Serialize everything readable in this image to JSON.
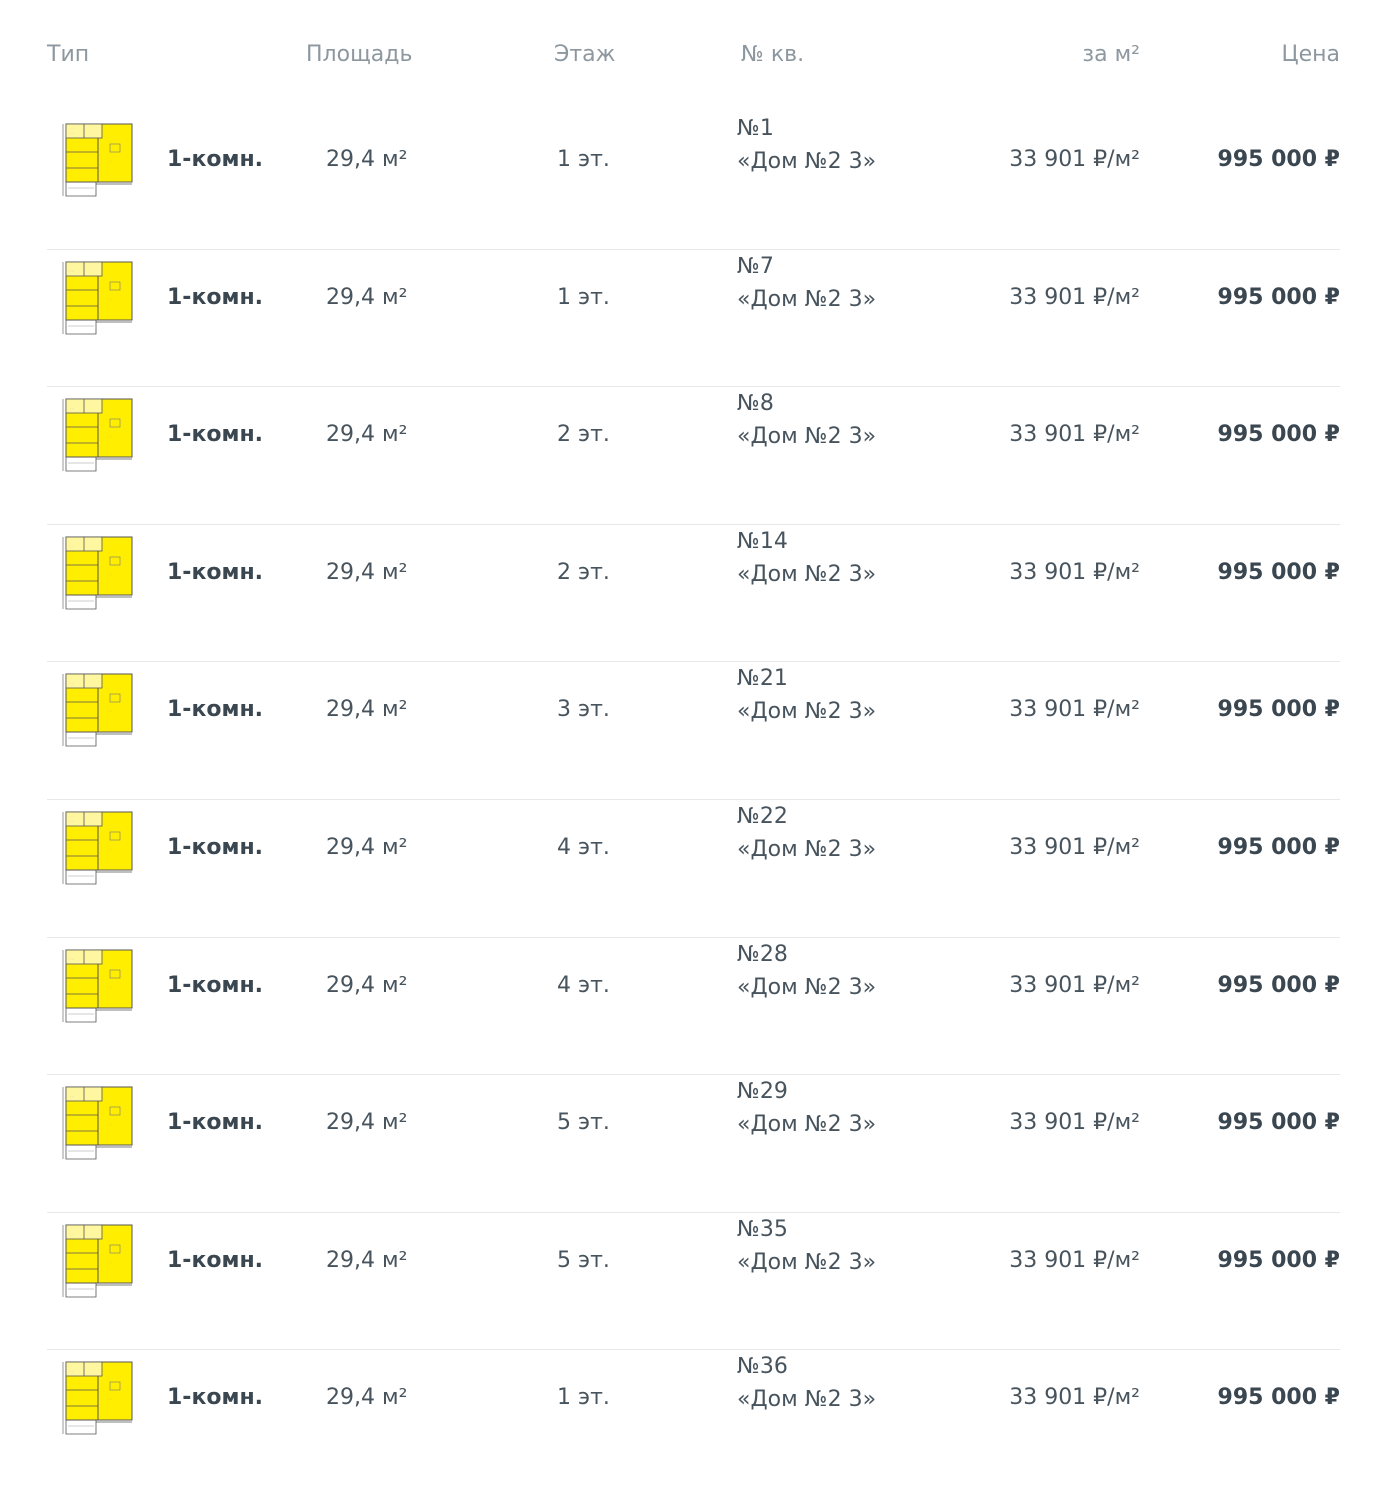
{
  "header": {
    "type": "Тип",
    "area": "Площадь",
    "floor": "Этаж",
    "num": "№ кв.",
    "ppm": "за м²",
    "price": "Цена"
  },
  "rows": [
    {
      "type": "1-комн.",
      "area": "29,4 м²",
      "floor": "1 эт.",
      "num": "№1",
      "house": "«Дом №2 3»",
      "ppm": "33 901 ₽/м²",
      "price": "995 000 ₽"
    },
    {
      "type": "1-комн.",
      "area": "29,4 м²",
      "floor": "1 эт.",
      "num": "№7",
      "house": "«Дом №2 3»",
      "ppm": "33 901 ₽/м²",
      "price": "995 000 ₽"
    },
    {
      "type": "1-комн.",
      "area": "29,4 м²",
      "floor": "2 эт.",
      "num": "№8",
      "house": "«Дом №2 3»",
      "ppm": "33 901 ₽/м²",
      "price": "995 000 ₽"
    },
    {
      "type": "1-комн.",
      "area": "29,4 м²",
      "floor": "2 эт.",
      "num": "№14",
      "house": "«Дом №2 3»",
      "ppm": "33 901 ₽/м²",
      "price": "995 000 ₽"
    },
    {
      "type": "1-комн.",
      "area": "29,4 м²",
      "floor": "3 эт.",
      "num": "№21",
      "house": "«Дом №2 3»",
      "ppm": "33 901 ₽/м²",
      "price": "995 000 ₽"
    },
    {
      "type": "1-комн.",
      "area": "29,4 м²",
      "floor": "4 эт.",
      "num": "№22",
      "house": "«Дом №2 3»",
      "ppm": "33 901 ₽/м²",
      "price": "995 000 ₽"
    },
    {
      "type": "1-комн.",
      "area": "29,4 м²",
      "floor": "4 эт.",
      "num": "№28",
      "house": "«Дом №2 3»",
      "ppm": "33 901 ₽/м²",
      "price": "995 000 ₽"
    },
    {
      "type": "1-комн.",
      "area": "29,4 м²",
      "floor": "5 эт.",
      "num": "№29",
      "house": "«Дом №2 3»",
      "ppm": "33 901 ₽/м²",
      "price": "995 000 ₽"
    },
    {
      "type": "1-комн.",
      "area": "29,4 м²",
      "floor": "5 эт.",
      "num": "№35",
      "house": "«Дом №2 3»",
      "ppm": "33 901 ₽/м²",
      "price": "995 000 ₽"
    },
    {
      "type": "1-комн.",
      "area": "29,4 м²",
      "floor": "1 эт.",
      "num": "№36",
      "house": "«Дом №2 3»",
      "ppm": "33 901 ₽/м²",
      "price": "995 000 ₽"
    }
  ],
  "colors": {
    "plan_fill": "#ffee00",
    "plan_wall": "#555555",
    "divider": "#e6e9ec"
  },
  "icons": {
    "plan": "floor-plan-icon"
  }
}
